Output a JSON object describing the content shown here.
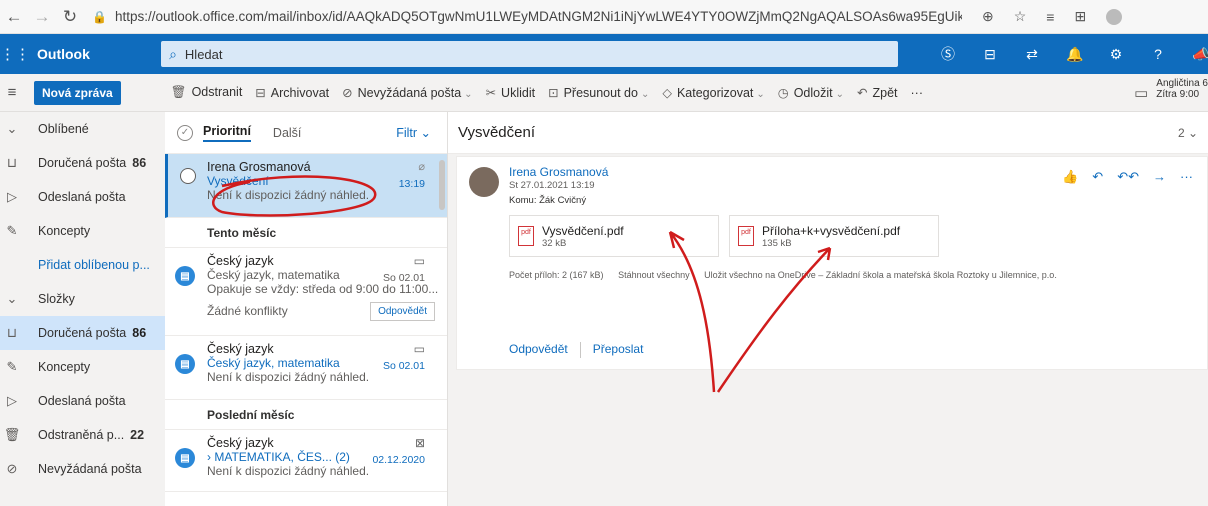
{
  "browser": {
    "back": "←",
    "forward": "→",
    "reload": "↻",
    "lock": "🔒",
    "url": "https://outlook.office.com/mail/inbox/id/AAQkADQ5OTgwNmU1LWEyMDAtNGM2Ni1iNjYwLWE4YTY0OWZjMmQ2NgAQALSOAs6wa95EgUikGP3z7Zk...",
    "icons": [
      "⊕",
      "☆",
      "≡",
      "⊞"
    ]
  },
  "top": {
    "app": "Outlook",
    "search_placeholder": "Hledat",
    "icons": [
      "Ⓢ",
      "⊟",
      "⇄",
      "🔔",
      "⚙",
      "?",
      "📣"
    ]
  },
  "cmd": {
    "new_mail": "Nová zpráva",
    "items": [
      {
        "icon": "🗑",
        "label": "Odstranit"
      },
      {
        "icon": "⊟",
        "label": "Archivovat"
      },
      {
        "icon": "⊘",
        "label": "Nevyžádaná pošta",
        "dd": true
      },
      {
        "icon": "✂",
        "label": "Uklidit"
      },
      {
        "icon": "⊡",
        "label": "Přesunout do",
        "dd": true
      },
      {
        "icon": "◇",
        "label": "Kategorizovat",
        "dd": true
      },
      {
        "icon": "◷",
        "label": "Odložit",
        "dd": true
      },
      {
        "icon": "↶",
        "label": "Zpět"
      },
      {
        "icon": "",
        "label": "···"
      }
    ],
    "reminder_title": "Angličtina 6",
    "reminder_time": "Zítra 9:00"
  },
  "nav": {
    "items": [
      {
        "icon": "⌄",
        "label": "Oblíbené",
        "count": "",
        "type": "hdr"
      },
      {
        "icon": "⊔",
        "label": "Doručená pošta",
        "count": "86",
        "type": "item"
      },
      {
        "icon": "▷",
        "label": "Odeslaná pošta",
        "count": "",
        "type": "item"
      },
      {
        "icon": "✎",
        "label": "Koncepty",
        "count": "",
        "type": "item"
      },
      {
        "icon": "",
        "label": "Přidat oblíbenou p...",
        "count": "",
        "type": "link"
      },
      {
        "icon": "⌄",
        "label": "Složky",
        "count": "",
        "type": "hdr"
      },
      {
        "icon": "⊔",
        "label": "Doručená pošta",
        "count": "86",
        "type": "sel"
      },
      {
        "icon": "✎",
        "label": "Koncepty",
        "count": "",
        "type": "item"
      },
      {
        "icon": "▷",
        "label": "Odeslaná pošta",
        "count": "",
        "type": "item"
      },
      {
        "icon": "🗑",
        "label": "Odstraněná p...",
        "count": "22",
        "type": "item"
      },
      {
        "icon": "⊘",
        "label": "Nevyžádaná pošta",
        "count": "",
        "type": "item"
      }
    ]
  },
  "list": {
    "tab_focused": "Prioritní",
    "tab_other": "Další",
    "filter": "Filtr ⌄",
    "m1": {
      "from": "Irena Grosmanová",
      "subject": "Vysvědčení",
      "preview": "Není k dispozici žádný náhled.",
      "time": "13:19"
    },
    "sec1": "Tento měsíc",
    "m2": {
      "from": "Český jazyk",
      "subject": "Český jazyk, matematika",
      "preview": "Opakuje se vždy: středa od 9:00 do 11:00...",
      "date": "So 02.01",
      "conflict": "Žádné konflikty",
      "reply": "Odpovědět"
    },
    "m3": {
      "from": "Český jazyk",
      "subject": "Český jazyk, matematika",
      "preview": "Není k dispozici žádný náhled.",
      "date": "So 02.01"
    },
    "sec2": "Poslední měsíc",
    "m4": {
      "from": "Český jazyk",
      "subject": "› MATEMATIKA, ČES... (2)",
      "preview": "Není k dispozici žádný náhled.",
      "date": "02.12.2020"
    }
  },
  "read": {
    "title": "Vysvědčení",
    "att_count": "2 ⌄",
    "sender": "Irena Grosmanová",
    "date": "St 27.01.2021 13:19",
    "to": "Komu: Žák Cvičný",
    "att1": {
      "name": "Vysvědčení.pdf",
      "size": "32 kB"
    },
    "att2": {
      "name": "Příloha+k+vysvědčení.pdf",
      "size": "135 kB"
    },
    "att_info": "Počet příloh: 2 (167 kB)",
    "download_all": "Stáhnout všechny",
    "save_onedrive": "Uložit všechno na OneDrive – Základní škola a mateřská škola Roztoky u Jilemnice, p.o.",
    "reply": "Odpovědět",
    "forward": "Přeposlat",
    "acts": [
      "👍",
      "↶",
      "↶↶",
      "→",
      "···"
    ]
  },
  "colors": {
    "brand": "#0f6cbd",
    "annotation": "#d01c1c"
  }
}
